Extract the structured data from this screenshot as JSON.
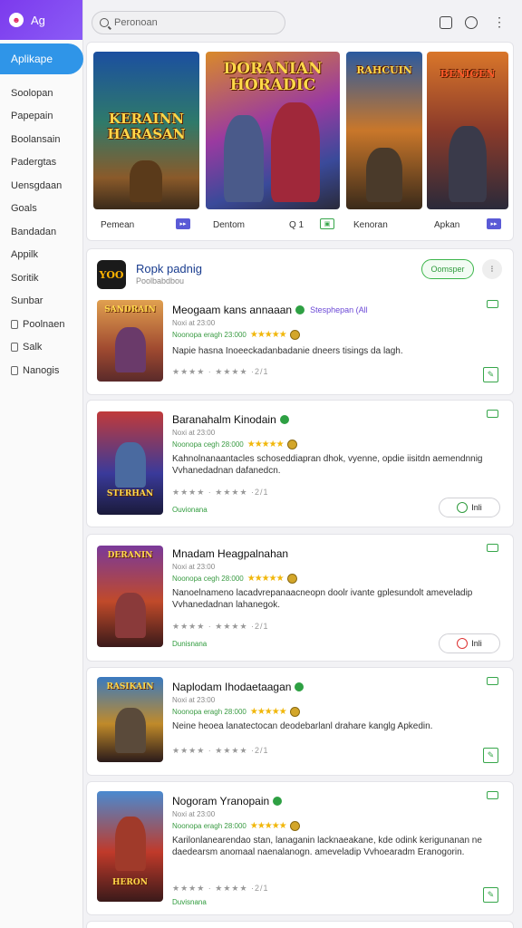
{
  "brand": {
    "logo": "☻",
    "name": "Ag"
  },
  "sidebar": {
    "active": "Aplikape",
    "items": [
      {
        "label": "Soolopan",
        "icon": ""
      },
      {
        "label": "Papepain",
        "icon": ""
      },
      {
        "label": "Boolansain",
        "icon": ""
      },
      {
        "label": "Padergtas",
        "icon": ""
      },
      {
        "label": "Uensgdaan",
        "icon": ""
      },
      {
        "label": "Goals",
        "icon": ""
      },
      {
        "label": "Bandadan",
        "icon": ""
      },
      {
        "label": "Appilk",
        "icon": ""
      },
      {
        "label": "Soritik",
        "icon": ""
      },
      {
        "label": "Sunbar",
        "icon": ""
      },
      {
        "label": "Poolnaen",
        "icon": "page-icon"
      },
      {
        "label": "Salk",
        "icon": "lock-icon"
      },
      {
        "label": "Nanogis",
        "icon": "page-icon"
      }
    ]
  },
  "search": {
    "placeholder": "Peronoan"
  },
  "banner": {
    "tiles": [
      {
        "art_title": "KERAINN HARASAN",
        "label": "Pemean",
        "badge": "▸▸"
      },
      {
        "art_title": "DORANIAN HORADIC",
        "label": "Dentom",
        "extra": "Q 1",
        "badge": "▣"
      },
      {
        "art_title": "RAHCUIN",
        "label": "Kenoran"
      },
      {
        "art_title": "BENIGEN",
        "label": "Apkan",
        "badge": "▸▸"
      }
    ]
  },
  "section": {
    "logo": "YOO",
    "title": "Ropk padnig",
    "subtitle": "Poolbabdbou",
    "pill": "Oomsper"
  },
  "apps": [
    {
      "art_title": "SANDRAIN",
      "name": "Meogaam kans annaaan",
      "dev": "Stesphepan (All",
      "size": "Noxi at 23:00",
      "meta": "Noonopa eragh 23:000",
      "stars": "★★★★★",
      "desc": "Napie hasna Inoeeckadanbadanie dneers tisings da lagh.",
      "rates": "★★★★  · ★★★★  ·2/1"
    },
    {
      "art_title": "STERHAN",
      "name": "Baranahalm Kinodain",
      "size": "Noxi at 23:00",
      "meta": "Noonopa cegh 28:000",
      "stars": "★★★★★",
      "desc": "Kahnolnanaantacles schoseddiapran dhok, vyenne, opdie iisitdn aemendnnig Vvhanedadnan dafanedcn.",
      "rates": "★★★★  · ★★★★  ·2/1",
      "cat": "Ouvionana",
      "action": "Inli"
    },
    {
      "art_title": "DERANIN",
      "name": "Mnadam Heagpalnahan",
      "size": "Noxi at 23:00",
      "meta": "Noonopa cegh 28:000",
      "stars": "★★★★★",
      "desc": "Nanoelnameno lacadvrepanaacneopn doolr ivante gplesundolt ameveladip Vvhanedadnan lahanegok.",
      "rates": "★★★★  · ★★★★  ·2/1",
      "cat": "Dunisnana",
      "action": "Inli"
    },
    {
      "art_title": "RASIKAIN",
      "name": "Naplodam Ihodaetaagan",
      "size": "Noxi at 23:00",
      "meta": "Noonopa eragh 28:000",
      "stars": "★★★★★",
      "desc": "Neine heoea lanatectocan deodebarlanl drahare kanglg Apkedin.",
      "rates": "★★★★  · ★★★★  ·2/1"
    },
    {
      "art_title": "HERON",
      "name": "Nogoram Yranopain",
      "size": "Noxi at 23:00",
      "meta": "Noonopa eragh 28:000",
      "stars": "★★★★★",
      "desc": "Karilonlanearendao stan, lanaganin lacknaeakane, kde odink kerigunanan ne daedearsm anomaal naenalanogn. ameveladip Vvhoearadm Eranogorin.",
      "rates": "★★★★  · ★★★★  ·2/1",
      "cat": "Duvisnana"
    }
  ],
  "colors": {
    "accent": "#2f95e8",
    "brand": "#7c3aed",
    "green": "#2e9b3c",
    "link": "#1a3d8f"
  }
}
